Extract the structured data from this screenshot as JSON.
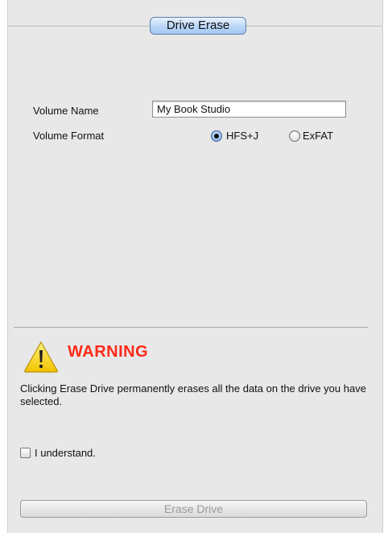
{
  "tab": {
    "label": "Drive Erase"
  },
  "form": {
    "volume_name_label": "Volume Name",
    "volume_name_value": "My Book Studio",
    "volume_format_label": "Volume Format",
    "format_options": [
      {
        "label": "HFS+J",
        "selected": true
      },
      {
        "label": "ExFAT",
        "selected": false
      }
    ]
  },
  "warning": {
    "icon": "warning-triangle-icon",
    "title": "WARNING",
    "message": "Clicking Erase Drive permanently erases all the data on the drive you have selected.",
    "title_color": "#ff2a1a"
  },
  "confirm": {
    "checkbox_label": "I understand.",
    "checked": false
  },
  "actions": {
    "erase_label": "Erase Drive",
    "enabled": false
  }
}
